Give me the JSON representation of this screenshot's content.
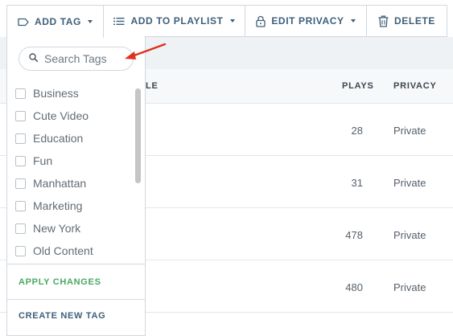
{
  "toolbar": {
    "add_tag_label": "ADD TAG",
    "add_to_playlist_label": "ADD TO PLAYLIST",
    "edit_privacy_label": "EDIT PRIVACY",
    "delete_label": "DELETE"
  },
  "table": {
    "header": {
      "title_fragment": "LE",
      "plays": "PLAYS",
      "privacy": "PRIVACY"
    },
    "rows": [
      {
        "plays": "28",
        "privacy": "Private"
      },
      {
        "plays": "31",
        "privacy": "Private"
      },
      {
        "plays": "478",
        "privacy": "Private"
      },
      {
        "plays": "480",
        "privacy": "Private"
      }
    ]
  },
  "tag_dropdown": {
    "search_placeholder": "Search Tags",
    "tags": [
      "Business",
      "Cute Video",
      "Education",
      "Fun",
      "Manhattan",
      "Marketing",
      "New York",
      "Old Content"
    ],
    "apply_label": "APPLY CHANGES",
    "create_label": "CREATE NEW TAG"
  },
  "colors": {
    "accent_blue": "#3e5f79",
    "apply_green": "#48a862",
    "annotation_arrow": "#e0301e",
    "border": "#cfd8e0"
  },
  "icons": {
    "add_tag": "tag-icon",
    "add_to_playlist": "list-icon",
    "edit_privacy": "lock-icon",
    "delete": "trash-icon",
    "search": "search-icon"
  }
}
